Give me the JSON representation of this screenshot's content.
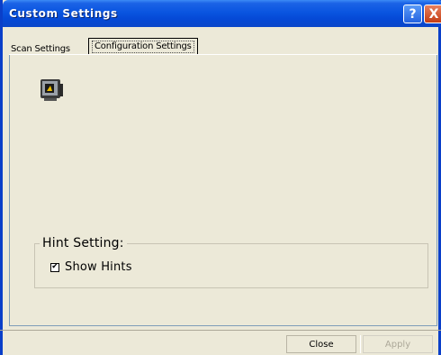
{
  "window": {
    "title": "Custom Settings",
    "help_label": "?",
    "close_label": "X"
  },
  "tabs": [
    {
      "label": "Scan Settings",
      "selected": false
    },
    {
      "label": "Configuration Settings",
      "selected": true
    }
  ],
  "content": {
    "icon": "monitor-icon",
    "hint_group": {
      "title": "Hint Setting:",
      "show_hints_label": "Show Hints",
      "show_hints_checked": true,
      "check_glyph": "✔"
    }
  },
  "buttons": {
    "close_label": "Close",
    "apply_label": "Apply",
    "apply_enabled": false
  }
}
